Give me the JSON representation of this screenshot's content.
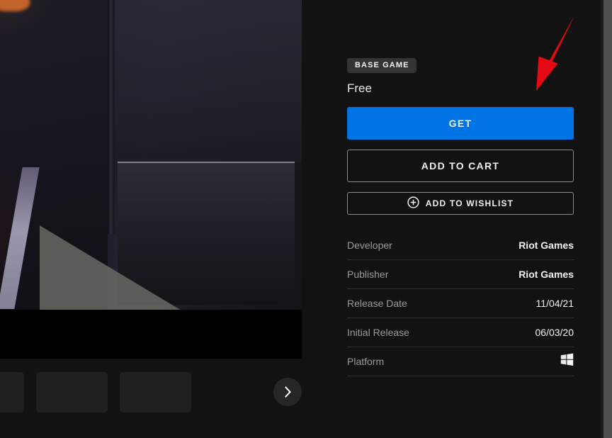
{
  "store_page": {
    "media_gallery": {
      "hero_alt": "valorant-gameplay-screenshot",
      "thumbnails": [
        "thumbnail-1",
        "thumbnail-2",
        "thumbnail-3"
      ],
      "next_button_icon": "chevron-right-icon"
    },
    "purchase": {
      "badge": "BASE GAME",
      "price": "Free",
      "get_label": "GET",
      "add_to_cart_label": "ADD TO CART",
      "add_to_wishlist_label": "ADD TO WISHLIST",
      "wishlist_icon": "plus-circle-icon",
      "accent_color": "#0074e4"
    },
    "metadata": {
      "rows": [
        {
          "label": "Developer",
          "value": "Riot Games",
          "type": "text"
        },
        {
          "label": "Publisher",
          "value": "Riot Games",
          "type": "text"
        },
        {
          "label": "Release Date",
          "value": "11/04/21",
          "type": "date"
        },
        {
          "label": "Initial Release",
          "value": "06/03/20",
          "type": "date"
        },
        {
          "label": "Platform",
          "value": "windows-icon",
          "type": "icon"
        }
      ]
    },
    "annotation": {
      "type": "arrow",
      "color": "#e50914",
      "points_to": "get-button"
    }
  }
}
